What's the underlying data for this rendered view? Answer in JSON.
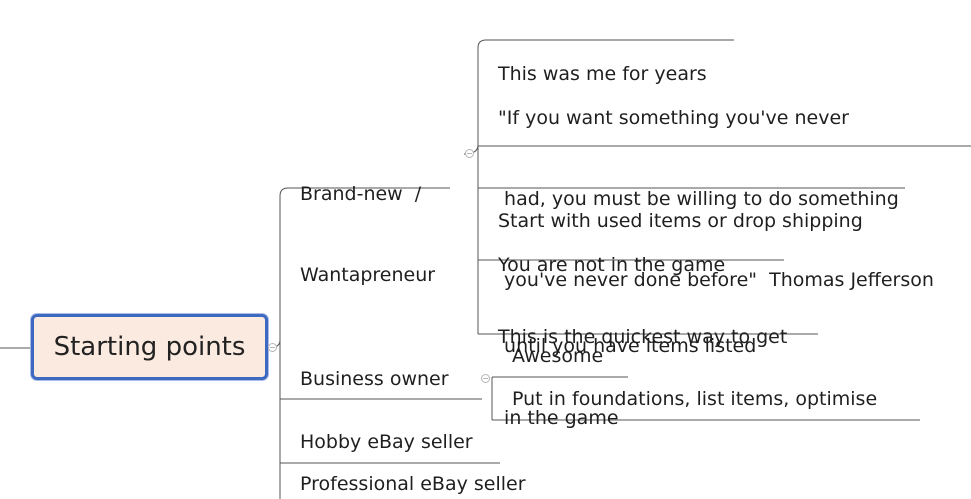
{
  "mindmap": {
    "central": "Starting points",
    "branches": [
      {
        "line1": "Brand-new  /",
        "line2": "Wantapreneur"
      },
      {
        "label": "Business owner"
      },
      {
        "label": "Hobby eBay seller"
      },
      {
        "label": "Professional eBay seller"
      }
    ],
    "brand_new_children": [
      {
        "lines": [
          "This was me for years"
        ]
      },
      {
        "lines": [
          "\"If you want something you've never",
          " had, you must be willing to do something",
          " you've never done before\"  Thomas Jefferson"
        ]
      },
      {
        "lines": [
          "Start with used items or drop shipping"
        ]
      },
      {
        "lines": [
          "You are not in the game",
          " until you have items listed"
        ]
      },
      {
        "lines": [
          "This is the quickest way to get",
          " in the game"
        ]
      }
    ],
    "business_owner_children": [
      {
        "label": "Awesome"
      },
      {
        "label": "Put in foundations, list items, optimise"
      }
    ]
  }
}
